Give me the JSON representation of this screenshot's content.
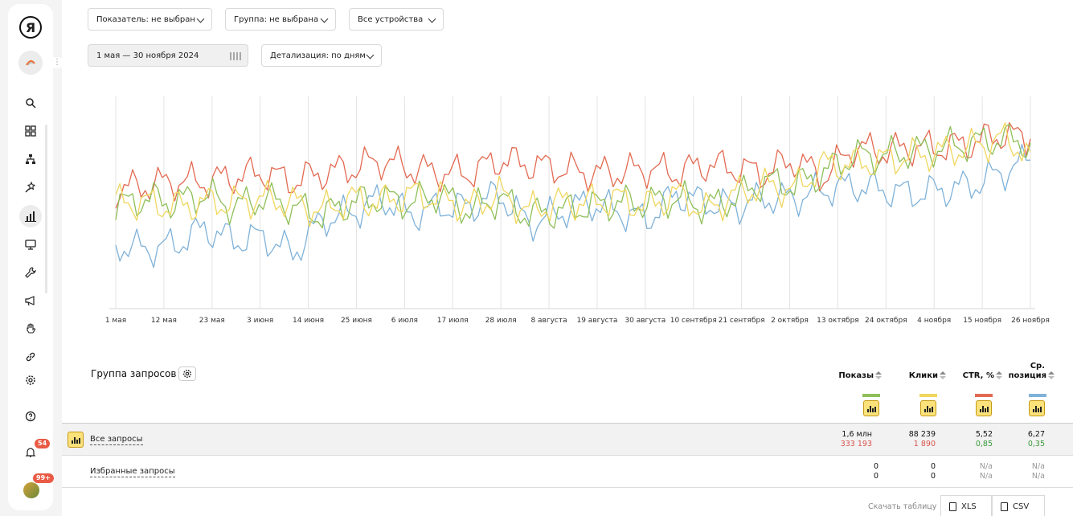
{
  "sidebar": {
    "logo": "Я",
    "notifications_badge": "54",
    "user_badge": "99+",
    "icons": [
      "search-icon",
      "apps-icon",
      "sitemap-icon",
      "star-wand-icon",
      "bar-chart-icon",
      "monitor-icon",
      "wrench-icon",
      "megaphone-icon",
      "hand-icon",
      "link-icon",
      "gear-icon",
      "help-icon",
      "bell-icon"
    ]
  },
  "filters": {
    "indicator": "Показатель: не выбран",
    "group": "Группа: не выбрана",
    "devices": "Все устройства",
    "date_range": "1 мая — 30 ноября 2024",
    "detail": "Детализация: по дням"
  },
  "chart_data": {
    "type": "line",
    "x_ticks": [
      "1 мая",
      "12 мая",
      "23 мая",
      "3 июня",
      "14 июня",
      "25 июня",
      "6 июля",
      "17 июля",
      "28 июля",
      "8 августа",
      "19 августа",
      "30 августа",
      "10 сентября",
      "21 сентября",
      "2 октября",
      "13 октября",
      "24 октября",
      "4 ноября",
      "15 ноября",
      "26 ноября"
    ],
    "grid": "vertical",
    "legend": "none",
    "series": [
      {
        "color": "#7fb2d9",
        "values": [
          0.7,
          0.72,
          0.7,
          0.62,
          0.68,
          0.66,
          0.74,
          0.58,
          0.55,
          0.48,
          0.56,
          0.52,
          0.52,
          0.46,
          0.6,
          0.55,
          0.5,
          0.54,
          0.58,
          0.46,
          0.5,
          0.52,
          0.48,
          0.48,
          0.44,
          0.42,
          0.44,
          0.46,
          0.44,
          0.42,
          0.36,
          0.3
        ]
      },
      {
        "color": "#e36a52",
        "values": [
          0.44,
          0.42,
          0.4,
          0.4,
          0.38,
          0.36,
          0.4,
          0.36,
          0.34,
          0.3,
          0.34,
          0.36,
          0.36,
          0.3,
          0.32,
          0.34,
          0.36,
          0.36,
          0.34,
          0.36,
          0.32,
          0.34,
          0.36,
          0.3,
          0.38,
          0.24,
          0.26,
          0.24,
          0.24,
          0.22,
          0.18,
          0.2
        ]
      },
      {
        "color": "#8fbf5a",
        "values": [
          0.52,
          0.48,
          0.5,
          0.46,
          0.52,
          0.48,
          0.52,
          0.56,
          0.5,
          0.48,
          0.5,
          0.46,
          0.54,
          0.48,
          0.56,
          0.54,
          0.52,
          0.5,
          0.5,
          0.48,
          0.52,
          0.48,
          0.4,
          0.42,
          0.36,
          0.28,
          0.28,
          0.26,
          0.24,
          0.22,
          0.2,
          0.22
        ]
      },
      {
        "color": "#f0d75e",
        "values": [
          0.5,
          0.5,
          0.52,
          0.5,
          0.5,
          0.48,
          0.5,
          0.54,
          0.48,
          0.5,
          0.46,
          0.48,
          0.52,
          0.46,
          0.54,
          0.5,
          0.5,
          0.48,
          0.52,
          0.46,
          0.54,
          0.46,
          0.42,
          0.44,
          0.32,
          0.32,
          0.3,
          0.28,
          0.26,
          0.24,
          0.2,
          0.26
        ]
      }
    ]
  },
  "table": {
    "title": "Группа запросов",
    "columns": [
      {
        "label": "Показы",
        "color": "#8fbf5a"
      },
      {
        "label": "Клики",
        "color": "#f0d75e"
      },
      {
        "label": "CTR, %",
        "color": "#e36a52"
      },
      {
        "label_l1": "Ср.",
        "label_l2": "позиция",
        "color": "#7fb2d9"
      }
    ],
    "rows": [
      {
        "name": "Все запросы",
        "values": [
          "1,6 млн",
          "88 239",
          "5,52",
          "6,27"
        ],
        "deltas": [
          "333 193",
          "1 890",
          "0,85",
          "0,35"
        ]
      },
      {
        "name": "Избранные запросы",
        "values": [
          "0",
          "0",
          "N/a",
          "N/a"
        ],
        "deltas": [
          "0",
          "0",
          "N/a",
          "N/a"
        ]
      }
    ],
    "download_label": "Скачать таблицу",
    "xls": "XLS",
    "csv": "CSV"
  }
}
